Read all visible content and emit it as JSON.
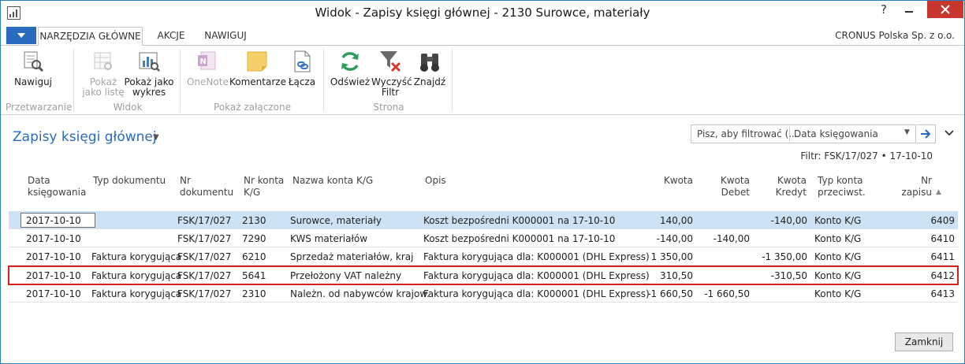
{
  "window": {
    "title": "Widok - Zapisy księgi głównej - 2130 Surowce, materiały",
    "help_label": "?"
  },
  "ribbon": {
    "tabs": [
      "NARZĘDZIA GŁÓWNE",
      "AKCJE",
      "NAWIGUJ"
    ],
    "company": "CRONUS Polska Sp. z o.o.",
    "buttons": {
      "navigate": "Nawiguj",
      "show_as_list_1": "Pokaż",
      "show_as_list_2": "jako listę",
      "show_as_chart_1": "Pokaż jako",
      "show_as_chart_2": "wykres",
      "onenote": "OneNote",
      "notes": "Komentarze",
      "links": "Łącza",
      "refresh": "Odśwież",
      "clear_filter_1": "Wyczyść",
      "clear_filter_2": "Filtr",
      "find": "Znajdź"
    },
    "groups": {
      "process": "Przetwarzanie",
      "view": "Widok",
      "show_attached": "Pokaż załączone",
      "page": "Strona"
    }
  },
  "page": {
    "title": "Zapisy księgi głównej",
    "filter_placeholder": "Pisz, aby filtrować (...",
    "filter_field": "Data księgowania",
    "filter_summary": "Filtr: FSK/17/027 • 17-10-10"
  },
  "columns": {
    "posting_date_1": "Data",
    "posting_date_2": "księgowania",
    "doc_type": "Typ dokumentu",
    "doc_no_1": "Nr",
    "doc_no_2": "dokumentu",
    "gl_acc_1": "Nr konta",
    "gl_acc_2": "K/G",
    "gl_name": "Nazwa konta K/G",
    "description": "Opis",
    "amount": "Kwota",
    "debit_1": "Kwota",
    "debit_2": "Debet",
    "credit_1": "Kwota",
    "credit_2": "Kredyt",
    "bal_type_1": "Typ konta",
    "bal_type_2": "przeciwst.",
    "entry_no_1": "Nr",
    "entry_no_2": "zapisu"
  },
  "rows": [
    {
      "date": "2017-10-10",
      "doc_type": "",
      "doc_no": "FSK/17/027",
      "acc": "2130",
      "name": "Surowce, materiały",
      "desc": "Koszt bezpośredni K000001 na 17-10-10",
      "amount": "140,00",
      "debit": "",
      "credit": "-140,00",
      "bal_type": "Konto K/G",
      "entry": "6409"
    },
    {
      "date": "2017-10-10",
      "doc_type": "",
      "doc_no": "FSK/17/027",
      "acc": "7290",
      "name": "KWS materiałów",
      "desc": "Koszt bezpośredni K000001 na 17-10-10",
      "amount": "-140,00",
      "debit": "-140,00",
      "credit": "",
      "bal_type": "Konto K/G",
      "entry": "6410"
    },
    {
      "date": "2017-10-10",
      "doc_type": "Faktura korygująca",
      "doc_no": "FSK/17/027",
      "acc": "6210",
      "name": "Sprzedaż materiałów, kraj",
      "desc": "Faktura korygująca dla: K000001 (DHL Express)",
      "amount": "1 350,00",
      "debit": "",
      "credit": "-1 350,00",
      "bal_type": "Konto K/G",
      "entry": "6411"
    },
    {
      "date": "2017-10-10",
      "doc_type": "Faktura korygująca",
      "doc_no": "FSK/17/027",
      "acc": "5641",
      "name": "Przełożony VAT należny",
      "desc": "Faktura korygująca dla: K000001 (DHL Express)",
      "amount": "310,50",
      "debit": "",
      "credit": "-310,50",
      "bal_type": "Konto K/G",
      "entry": "6412"
    },
    {
      "date": "2017-10-10",
      "doc_type": "Faktura korygująca",
      "doc_no": "FSK/17/027",
      "acc": "2310",
      "name": "Należn. od nabywców krajow.",
      "desc": "Faktura korygująca dla: K000001 (DHL Express)",
      "amount": "-1 660,50",
      "debit": "-1 660,50",
      "credit": "",
      "bal_type": "Konto K/G",
      "entry": "6413"
    }
  ],
  "footer": {
    "close_label": "Zamknij"
  }
}
